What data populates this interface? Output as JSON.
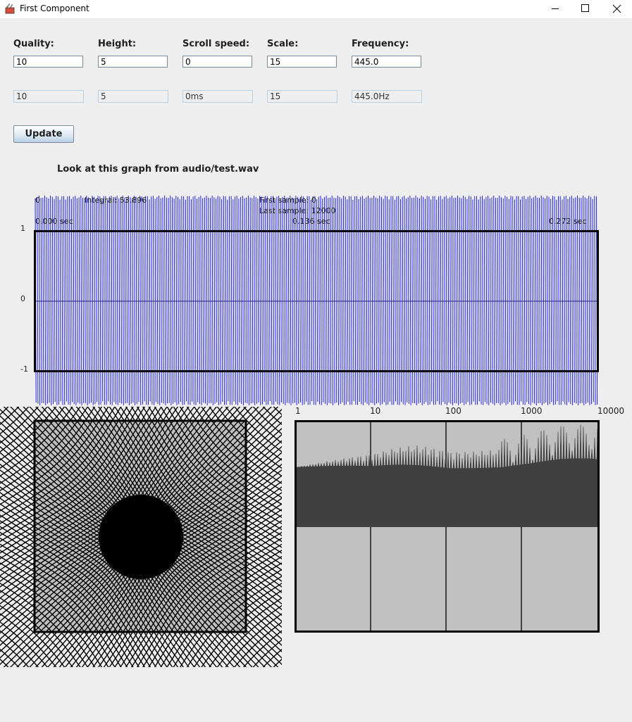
{
  "window": {
    "title": "First Component"
  },
  "controls": {
    "quality": {
      "label": "Quality:",
      "value": "10",
      "display": "10"
    },
    "height": {
      "label": "Height:",
      "value": "5",
      "display": "5"
    },
    "scroll": {
      "label": "Scroll speed:",
      "value": "0",
      "display": "0ms"
    },
    "scale": {
      "label": "Scale:",
      "value": "15",
      "display": "15"
    },
    "frequency": {
      "label": "Frequency:",
      "value": "445.0",
      "display": "445.0Hz"
    },
    "update_label": "Update"
  },
  "caption": "Look at this graph from audio/test.wav",
  "waveform": {
    "top_left": "0",
    "integral": "Integral: 53.896",
    "first_sample": "First sample: 0",
    "last_sample": "Last sample: 12000",
    "time_start": "0.000 sec",
    "time_mid": "0.136 sec",
    "time_end": "0.272 sec",
    "y_top": "1",
    "y_mid": "0",
    "y_bottom": "-1",
    "waveColor": "#2020dd"
  },
  "spectrum": {
    "ticks": [
      "1",
      "10",
      "100",
      "1000",
      "10000"
    ],
    "fillColor": "#404040",
    "bgColor": "#c0c0c0"
  }
}
